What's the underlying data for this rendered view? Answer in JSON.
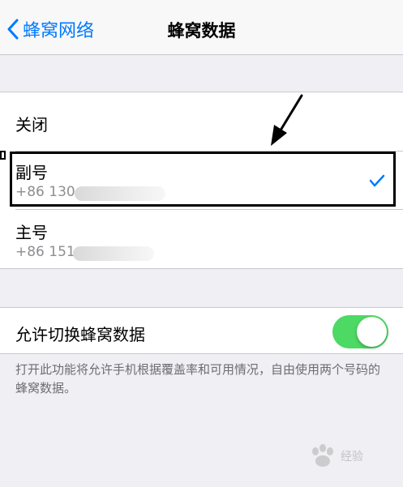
{
  "navbar": {
    "back_label": "蜂窝网络",
    "title": "蜂窝数据"
  },
  "line_options": [
    {
      "label": "关闭",
      "number": "",
      "selected": false
    },
    {
      "label": "副号",
      "number": "+86 130",
      "selected": true
    },
    {
      "label": "主号",
      "number": "+86 151",
      "selected": false
    }
  ],
  "switching": {
    "label": "允许切换蜂窝数据",
    "enabled": true,
    "footer": "打开此功能将允许手机根据覆盖率和可用情况，自由使用两个号码的蜂窝数据。"
  },
  "watermark": {
    "text": "经验"
  },
  "colors": {
    "accent": "#007aff",
    "toggle_on": "#4cd964",
    "background": "#efeff4"
  },
  "icons": {
    "back": "chevron-left-icon",
    "selected": "checkmark-icon",
    "annotation": "arrow-annotation-icon"
  }
}
